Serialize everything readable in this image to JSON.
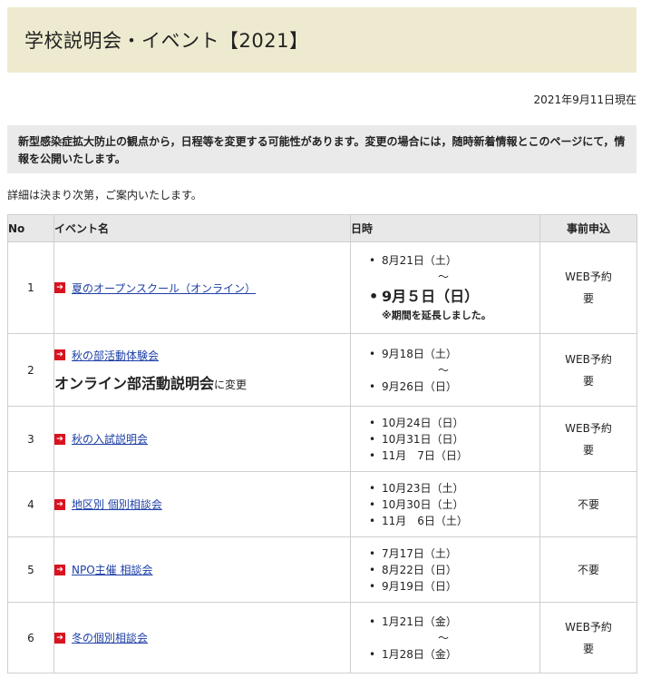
{
  "title": "学校説明会・イベント【2021】",
  "as_of": "2021年9月11日現在",
  "notice": "新型感染症拡大防止の観点から，日程等を変更する可能性があります。変更の場合には，随時新着情報とこのページにて，情報を公開いたします。",
  "detail": "詳細は決まり次第，ご案内いたします。",
  "table": {
    "headers": {
      "no": "No",
      "name": "イベント名",
      "date": "日時",
      "apply": "事前申込"
    },
    "rows": [
      {
        "no": "1",
        "name": "夏のオープンスクール（オンライン）",
        "date1": "8月21日（土）",
        "tilde": "～",
        "date2": "9月５日（日）",
        "note": "※期間を延長しました。",
        "apply1": "WEB予約",
        "apply2": "要"
      },
      {
        "no": "2",
        "name": "秋の部活動体験会",
        "note_big": "オンライン部活動説明会",
        "note_small": "に変更",
        "date1": "9月18日（土）",
        "tilde": "～",
        "date2": "9月26日（日）",
        "apply1": "WEB予約",
        "apply2": "要"
      },
      {
        "no": "3",
        "name": "秋の入試説明会",
        "dates": [
          "10月24日（日）",
          "10月31日（日）",
          "11月　7日（日）"
        ],
        "apply1": "WEB予約",
        "apply2": "要"
      },
      {
        "no": "4",
        "name": "地区別 個別相談会",
        "dates": [
          "10月23日（土）",
          "10月30日（土）",
          "11月　6日（土）"
        ],
        "apply1": "不要"
      },
      {
        "no": "5",
        "name": "NPO主催 相談会",
        "dates": [
          "7月17日（土）",
          "8月22日（日）",
          "9月19日（日）"
        ],
        "apply1": "不要"
      },
      {
        "no": "6",
        "name": "冬の個別相談会",
        "date1": "1月21日（金）",
        "tilde": "～",
        "date2": "1月28日（金）",
        "apply1": "WEB予約",
        "apply2": "要"
      }
    ]
  },
  "colors": {
    "title_bg": "#eeeacf",
    "notice_bg": "#eaeaea",
    "header_bg": "#e8e8e8",
    "arrow": "#d9121f",
    "link": "#1d3fa6"
  },
  "icons": {
    "arrow": "arrow-right-icon"
  }
}
